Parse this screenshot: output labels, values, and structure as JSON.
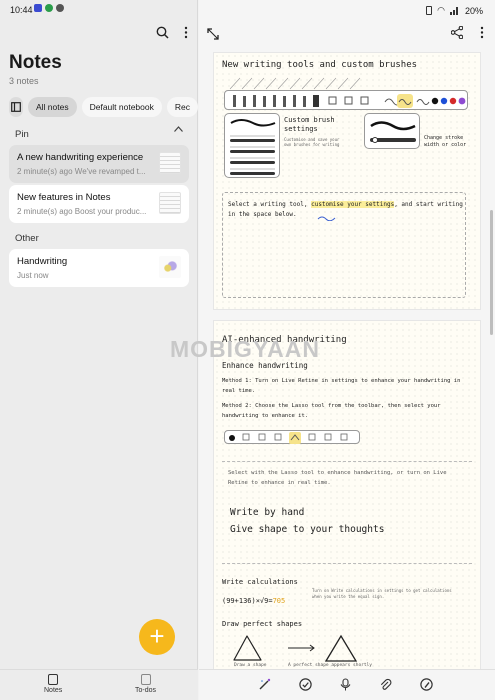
{
  "status": {
    "time": "10:44",
    "battery": "20%"
  },
  "left": {
    "title": "Notes",
    "count": "3 notes",
    "chips": [
      "All notes",
      "Default notebook",
      "Rec"
    ],
    "pin_label": "Pin",
    "other_label": "Other",
    "notes": [
      {
        "title": "A new handwriting experience",
        "subtitle": "2 minute(s) ago We've revamped t..."
      },
      {
        "title": "New features in Notes",
        "subtitle": "2 minute(s) ago Boost your produc..."
      },
      {
        "title": "Handwriting",
        "subtitle": "Just now"
      }
    ],
    "nav": {
      "notes": "Notes",
      "todos": "To-dos"
    },
    "fab": "+"
  },
  "right": {
    "watermark": "MOBIGYAAN",
    "p1": {
      "heading": "New writing tools and custom brushes",
      "custom_title": "Custom brush settings",
      "custom_sub": "Customise and save your own brushes for writing",
      "change_note": "Change stroke width or color",
      "prompt_a": "Select a writing tool, ",
      "prompt_hl": "customise your settings",
      "prompt_b": ", and start writing in the space below."
    },
    "p2": {
      "heading": "AI-enhanced handwriting",
      "sub": "Enhance handwriting",
      "m1": "Method 1: Turn on Live Retine in settings to enhance your handwriting in real time.",
      "m2": "Method 2: Choose the Lasso tool from the toolbar, then select your handwriting to enhance it.",
      "select_note": "Select with the Lasso tool to enhance handwriting, or turn on Live Retine to enhance in real time.",
      "write_by_hand": "Write by hand",
      "give_shape": "Give shape to your thoughts",
      "write_calc": "Write calculations",
      "calc": "(99+136)×√9=",
      "calc_result": "705",
      "calc_note": "Turn on Write calculations in settings to get calculations when you write the equal sign.",
      "draw_shapes": "Draw perfect shapes",
      "draw_a_shape": "Draw a shape",
      "perfect_shape": "A perfect shape appears shortly"
    }
  }
}
